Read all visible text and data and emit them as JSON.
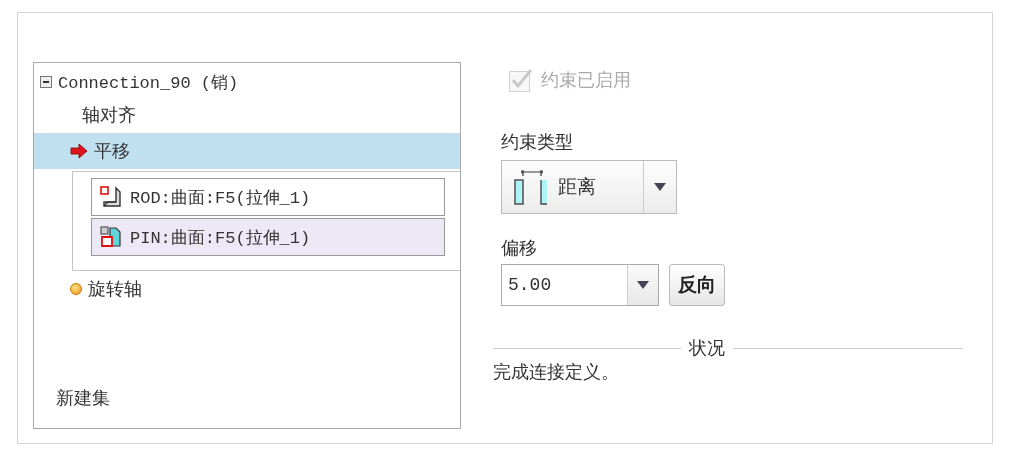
{
  "tree": {
    "label": "Connection_90 (销)",
    "expanded": true,
    "children": [
      {
        "label": "轴对齐",
        "kind": "plain",
        "selected": false
      },
      {
        "label": "平移",
        "kind": "current",
        "selected": true,
        "references": [
          {
            "text": "ROD:曲面:F5(拉伸_1)",
            "kind": "rod",
            "selected": false
          },
          {
            "text": "PIN:曲面:F5(拉伸_1)",
            "kind": "pin",
            "selected": true
          }
        ]
      },
      {
        "label": "旋转轴",
        "kind": "pending",
        "selected": false
      }
    ]
  },
  "new_set": "新建集",
  "enabled": {
    "label": "约束已启用",
    "checked": true,
    "disabled": true
  },
  "constraint_type": {
    "label": "约束类型",
    "value": "距离"
  },
  "offset": {
    "label": "偏移",
    "value": "5.00",
    "button": "反向"
  },
  "status": {
    "title": "状况",
    "message": "完成连接定义。"
  }
}
